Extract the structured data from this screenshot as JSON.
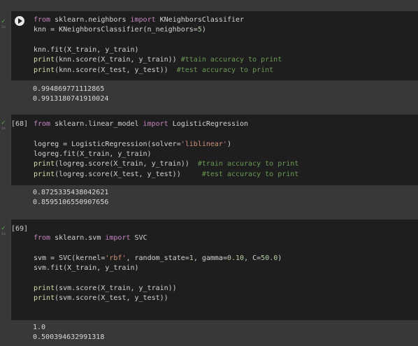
{
  "cells": [
    {
      "exec_count": "",
      "time": "2s",
      "lines": [
        [
          {
            "t": "from",
            "c": "kw"
          },
          {
            "t": " sklearn.neighbors ",
            "c": "pl"
          },
          {
            "t": "import",
            "c": "kw"
          },
          {
            "t": " KNeighborsClassifier",
            "c": "pl"
          }
        ],
        [
          {
            "t": "knn = KNeighborsClassifier(n_neighbors=",
            "c": "pl"
          },
          {
            "t": "5",
            "c": "num"
          },
          {
            "t": ")",
            "c": "pl"
          }
        ],
        [],
        [
          {
            "t": "knn.fit(X_train, y_train)",
            "c": "pl"
          }
        ],
        [
          {
            "t": "print",
            "c": "fn"
          },
          {
            "t": "(knn.score(X_train, y_train)) ",
            "c": "pl"
          },
          {
            "t": "#ttain accuracy to print",
            "c": "cm"
          }
        ],
        [
          {
            "t": "print",
            "c": "fn"
          },
          {
            "t": "(knn.score(X_test, y_test))  ",
            "c": "pl"
          },
          {
            "t": "#test accuracy to print",
            "c": "cm"
          }
        ]
      ],
      "output": [
        "0.994869771112865",
        "0.9913180741910024"
      ]
    },
    {
      "exec_count": "[68]",
      "time": "2s",
      "lines": [
        [
          {
            "t": "from",
            "c": "kw"
          },
          {
            "t": " sklearn.linear_model ",
            "c": "pl"
          },
          {
            "t": "import",
            "c": "kw"
          },
          {
            "t": " LogisticRegression",
            "c": "pl"
          }
        ],
        [],
        [
          {
            "t": "logreg = LogisticRegression(solver=",
            "c": "pl"
          },
          {
            "t": "'liblinear'",
            "c": "str"
          },
          {
            "t": ")",
            "c": "pl"
          }
        ],
        [
          {
            "t": "logreg.fit(X_train, y_train)",
            "c": "pl"
          }
        ],
        [
          {
            "t": "print",
            "c": "fn"
          },
          {
            "t": "(logreg.score(X_train, y_train))  ",
            "c": "pl"
          },
          {
            "t": "#train accuracy to print",
            "c": "cm"
          }
        ],
        [
          {
            "t": "print",
            "c": "fn"
          },
          {
            "t": "(logreg.score(X_test, y_test))     ",
            "c": "pl"
          },
          {
            "t": "#test accuracy to print",
            "c": "cm"
          }
        ]
      ],
      "output": [
        "0.8725335438042621",
        "0.8595106550907656"
      ]
    },
    {
      "exec_count": "[69]",
      "time": "1s",
      "lines": [
        [
          {
            "t": "from",
            "c": "kw"
          },
          {
            "t": " sklearn.svm ",
            "c": "pl"
          },
          {
            "t": "import",
            "c": "kw"
          },
          {
            "t": " SVC",
            "c": "pl"
          }
        ],
        [],
        [
          {
            "t": "svm = SVC(kernel=",
            "c": "pl"
          },
          {
            "t": "'rbf'",
            "c": "str"
          },
          {
            "t": ", random_state=",
            "c": "pl"
          },
          {
            "t": "1",
            "c": "num"
          },
          {
            "t": ", gamma=",
            "c": "pl"
          },
          {
            "t": "0.10",
            "c": "num"
          },
          {
            "t": ", C=",
            "c": "pl"
          },
          {
            "t": "50.0",
            "c": "num"
          },
          {
            "t": ")",
            "c": "pl"
          }
        ],
        [
          {
            "t": "svm.fit(X_train, y_train)",
            "c": "pl"
          }
        ],
        [],
        [
          {
            "t": "print",
            "c": "fn"
          },
          {
            "t": "(svm.score(X_train, y_train))",
            "c": "pl"
          }
        ],
        [
          {
            "t": "print",
            "c": "fn"
          },
          {
            "t": "(svm.score(X_test, y_test))",
            "c": "pl"
          }
        ]
      ],
      "output": [
        "1.0",
        "0.500394632991318"
      ]
    }
  ]
}
